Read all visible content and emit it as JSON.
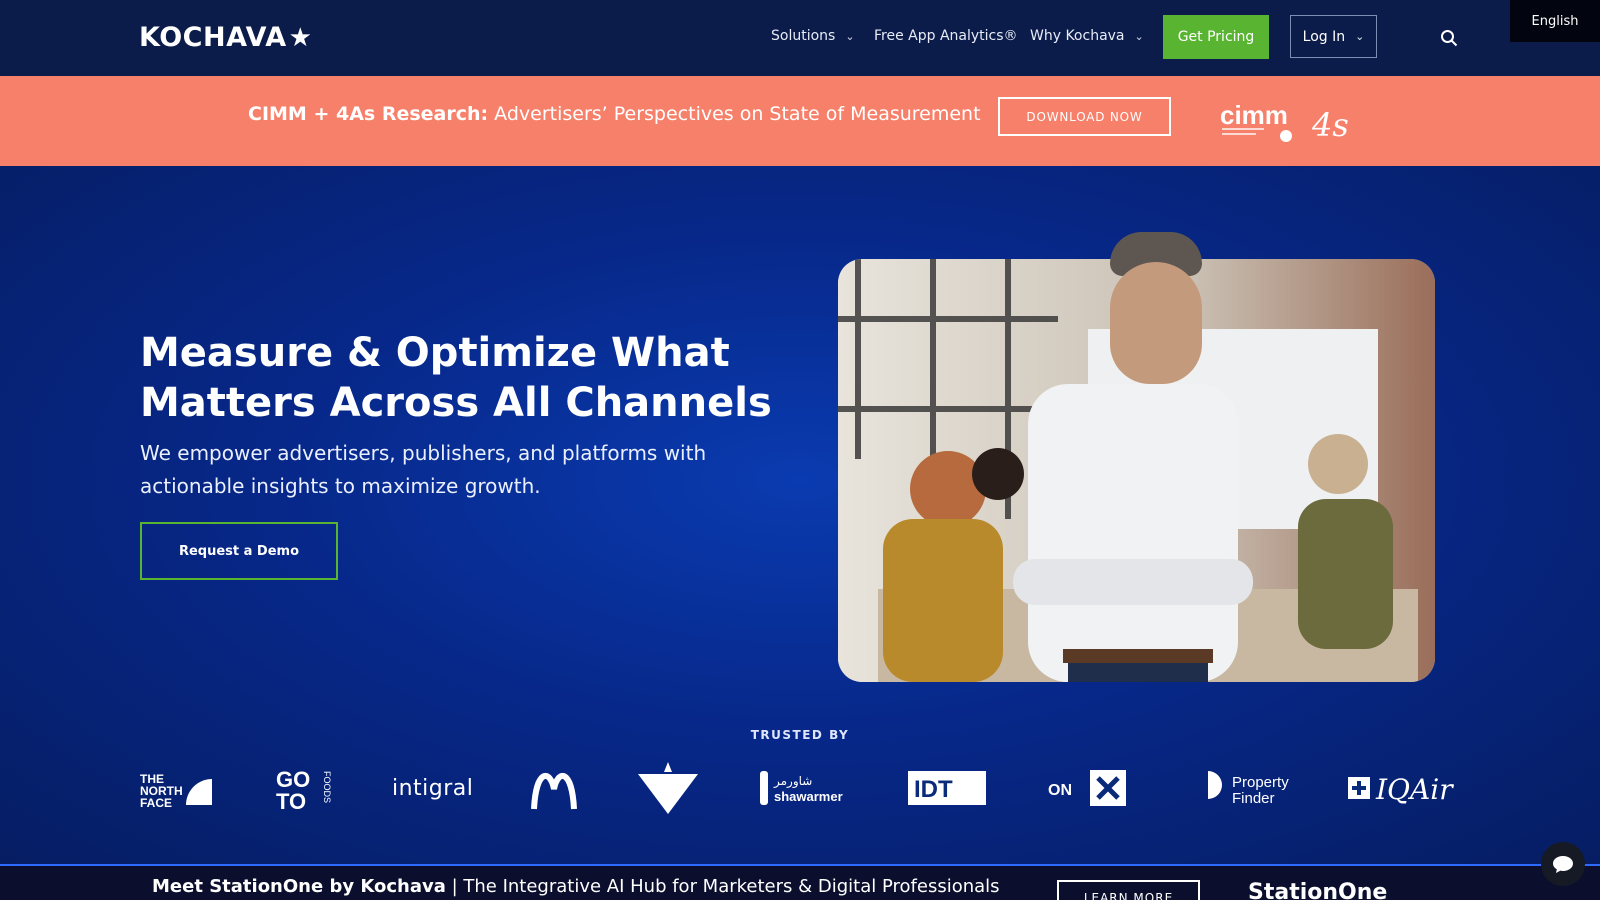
{
  "header": {
    "logo_text": "KOCHAVA",
    "nav": {
      "solutions": "Solutions",
      "free_app_analytics": "Free App Analytics®",
      "why_kochava": "Why Kochava"
    },
    "get_pricing": "Get Pricing",
    "log_in": "Log In",
    "language": "English"
  },
  "promo": {
    "bold": "CIMM + 4As Research:",
    "text": " Advertisers’ Perspectives on State of Measurement",
    "button": "DOWNLOAD NOW",
    "cimm_logo_text": "cimm",
    "foura_logo_text": "4s"
  },
  "hero": {
    "title": "Measure & Optimize What Matters Across All Channels",
    "subtitle": "We empower advertisers, publishers, and platforms with actionable insights to maximize growth.",
    "cta": "Request a Demo"
  },
  "trusted": {
    "label": "TRUSTED BY",
    "brands": [
      "THE NORTH FACE",
      "GO TO FOODS",
      "intigral",
      "M",
      "CANADIAN TIRE",
      "shawarmer",
      "IDT",
      "ON X",
      "Property Finder",
      "IQAir"
    ]
  },
  "bottom": {
    "bold": "Meet StationOne by Kochava",
    "text": " | The Integrative AI Hub for Marketers & Digital Professionals",
    "button": "LEARN MORE",
    "logo_text": "StationOne"
  },
  "colors": {
    "nav_bg": "#0b1b4a",
    "promo_bg": "#f7806b",
    "accent_green": "#58b431",
    "hero_blue": "#0a3bb0"
  }
}
